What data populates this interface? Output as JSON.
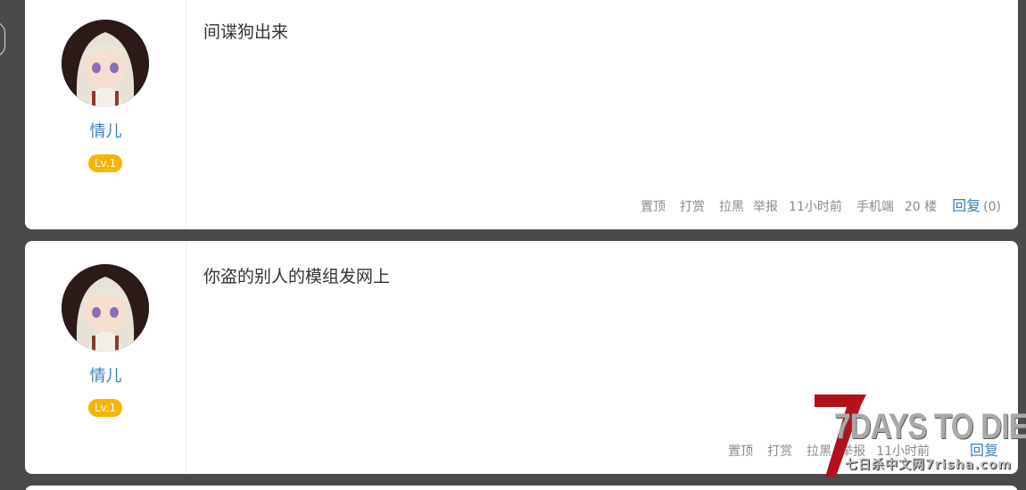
{
  "posts": [
    {
      "username": "情儿",
      "level": "Lv.1",
      "content": "间谍狗出来",
      "actions": {
        "pin": "置顶",
        "tip": "打赏",
        "block": "拉黑",
        "report": "举报",
        "time": "11小时前",
        "device": "手机端",
        "floor": "20 楼",
        "reply": "回复",
        "reply_count": "(0)"
      }
    },
    {
      "username": "情儿",
      "level": "Lv.1",
      "content": "你盗的别人的模组发网上",
      "actions": {
        "pin": "置顶",
        "tip": "打赏",
        "block": "拉黑",
        "report": "举报",
        "time": "11小时前",
        "device": "",
        "floor": "",
        "reply": "回复",
        "reply_count": ""
      }
    }
  ],
  "watermark": {
    "title": "7DAYS TO DIE",
    "subtitle": "七日杀中文网7risha.com"
  },
  "colors": {
    "page_background": "#4a4a4a",
    "link_blue": "#3a7fc1",
    "level_badge": "#f7b500",
    "muted_text": "#8a8a8a"
  }
}
